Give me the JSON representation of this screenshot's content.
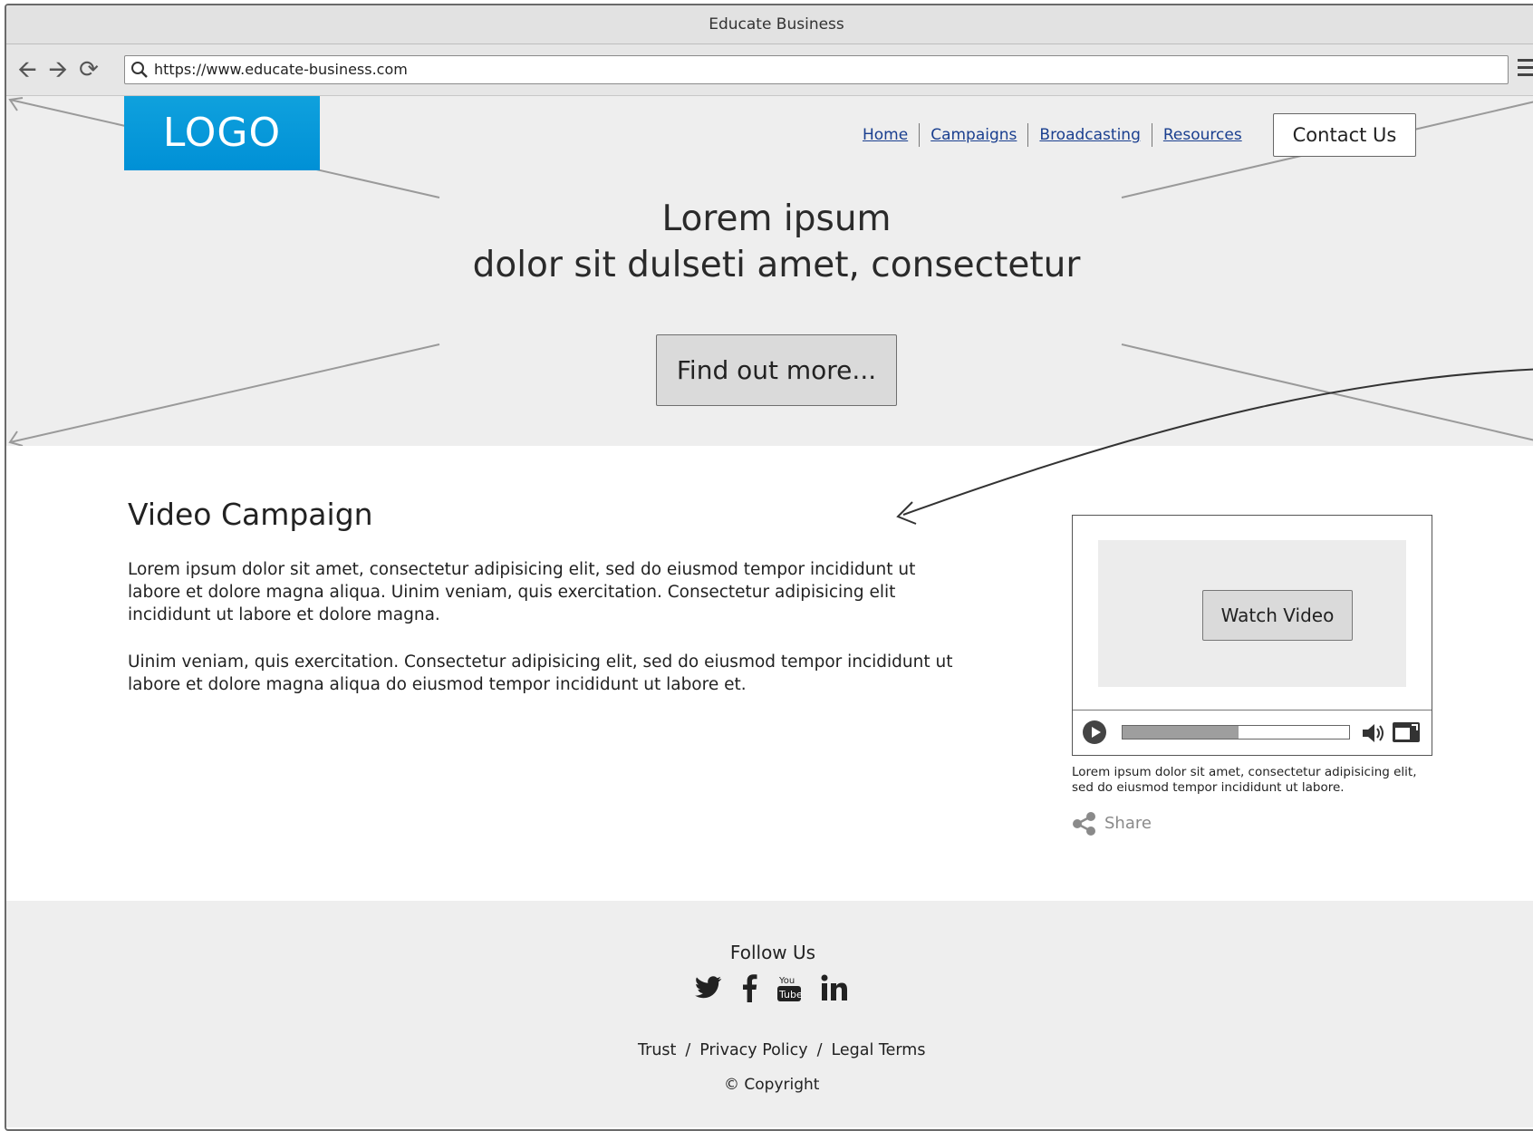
{
  "window": {
    "title": "Educate Business"
  },
  "toolbar": {
    "url": "https://www.educate-business.com",
    "back_icon": "back-arrow-icon",
    "forward_icon": "forward-arrow-icon",
    "reload_icon": "reload-icon",
    "menu_icon": "hamburger-menu-icon"
  },
  "header": {
    "logo": "LOGO",
    "nav": [
      "Home",
      "Campaigns",
      "Broadcasting",
      "Resources"
    ],
    "contact_label": "Contact Us"
  },
  "hero": {
    "title_line1": "Lorem ipsum",
    "title_line2": "dolor sit dulseti amet, consectetur",
    "cta_label": "Find out more..."
  },
  "content": {
    "title": "Video Campaign",
    "paragraphs": [
      "Lorem ipsum dolor sit amet, consectetur adipisicing elit, sed do eiusmod tempor incididunt ut labore et dolore magna aliqua. Uinim veniam, quis exercitation. Consectetur adipisicing elit incididunt ut labore et dolore magna.",
      "Uinim veniam, quis exercitation. Consectetur adipisicing elit, sed do eiusmod tempor incididunt ut labore et dolore magna aliqua do eiusmod tempor incididunt ut labore et."
    ]
  },
  "video": {
    "watch_label": "Watch Video",
    "progress": 0.51,
    "caption": "Lorem ipsum dolor sit amet, consectetur adipisicing elit, sed do eiusmod tempor incididunt ut labore.",
    "share_label": "Share"
  },
  "footer": {
    "follow_label": "Follow Us",
    "social": [
      "twitter-icon",
      "facebook-icon",
      "youtube-icon",
      "linkedin-icon"
    ],
    "links": [
      "Trust",
      "Privacy Policy",
      "Legal Terms"
    ],
    "copyright": "Copyright"
  },
  "colors": {
    "logo_blue": "#0fa1dd",
    "link_blue": "#1a3f8f",
    "hero_bg": "#eeeeee"
  }
}
